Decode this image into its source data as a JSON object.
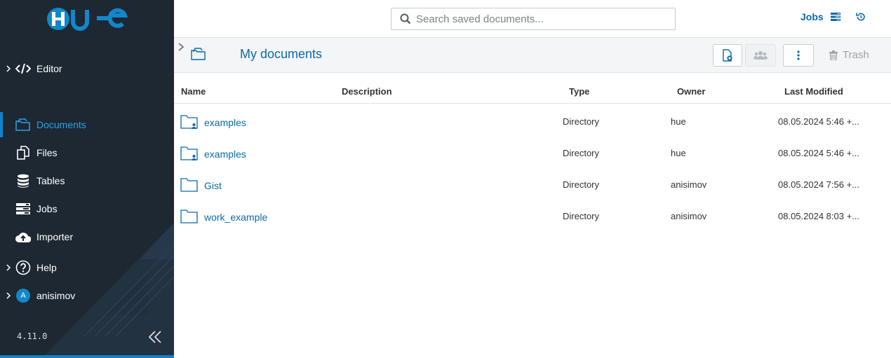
{
  "sidebar": {
    "editor_label": "Editor",
    "items": [
      {
        "label": "Documents",
        "icon": "documents-icon",
        "active": true
      },
      {
        "label": "Files",
        "icon": "files-icon"
      },
      {
        "label": "Tables",
        "icon": "tables-icon"
      },
      {
        "label": "Jobs",
        "icon": "jobs-icon"
      },
      {
        "label": "Importer",
        "icon": "importer-icon"
      }
    ],
    "help_label": "Help",
    "user_label": "anisimov",
    "user_initial": "A",
    "version": "4.11.0"
  },
  "topbar": {
    "search_placeholder": "Search saved documents...",
    "jobs_label": "Jobs"
  },
  "header": {
    "title": "My documents",
    "trash_label": "Trash"
  },
  "table": {
    "columns": {
      "name": "Name",
      "description": "Description",
      "type": "Type",
      "owner": "Owner",
      "modified": "Last Modified"
    },
    "rows": [
      {
        "name": "examples",
        "shared": true,
        "type": "Directory",
        "owner": "hue",
        "modified": "08.05.2024 5:46 +..."
      },
      {
        "name": "examples",
        "shared": true,
        "type": "Directory",
        "owner": "hue",
        "modified": "08.05.2024 5:46 +..."
      },
      {
        "name": "Gist",
        "shared": false,
        "type": "Directory",
        "owner": "anisimov",
        "modified": "08.05.2024 7:56 +..."
      },
      {
        "name": "work_example",
        "shared": false,
        "type": "Directory",
        "owner": "anisimov",
        "modified": "08.05.2024 8:03 +..."
      }
    ]
  },
  "colors": {
    "sidebar_bg": "#1d2833",
    "accent": "#0f84c8",
    "link": "#0b6aa8"
  }
}
